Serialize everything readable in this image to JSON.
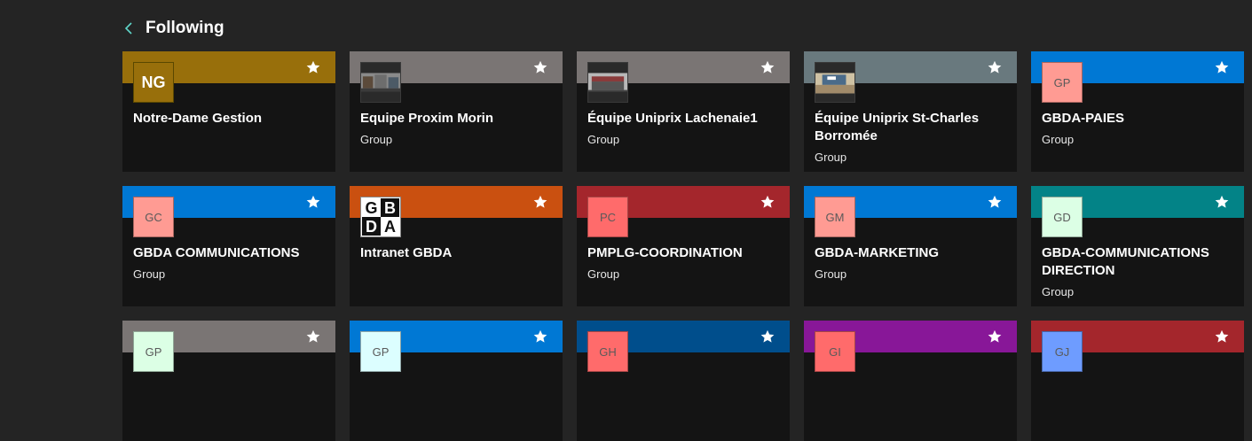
{
  "header": {
    "title": "Following"
  },
  "cards": [
    {
      "name": "Notre-Dame Gestion",
      "type": "",
      "initials": "NG",
      "band": "#986f0b",
      "logo_bg": "#986f0b",
      "logo_style": "bold"
    },
    {
      "name": "Equipe Proxim Morin",
      "type": "Group",
      "initials": "",
      "band": "#7a7574",
      "logo_bg": "#2a2a2a",
      "logo_style": "photo"
    },
    {
      "name": "Équipe Uniprix Lachenaie1",
      "type": "Group",
      "initials": "",
      "band": "#7a7574",
      "logo_bg": "#2a2a2a",
      "logo_style": "photo"
    },
    {
      "name": "Équipe Uniprix St-Charles Borromée",
      "type": "Group",
      "initials": "",
      "band": "#69797e",
      "logo_bg": "#2a2a2a",
      "logo_style": "photo"
    },
    {
      "name": "GBDA-PAIES",
      "type": "Group",
      "initials": "GP",
      "band": "#0078d4",
      "logo_bg": "#ff9b93",
      "logo_style": "initials"
    },
    {
      "name": "GBDA COMMUNICATIONS",
      "type": "Group",
      "initials": "GC",
      "band": "#0078d4",
      "logo_bg": "#ff9b93",
      "logo_style": "initials"
    },
    {
      "name": "Intranet GBDA",
      "type": "",
      "initials": "GBDA",
      "band": "#ca5010",
      "logo_bg": "#ffffff",
      "logo_style": "gbda"
    },
    {
      "name": "PMPLG-COORDINATION",
      "type": "Group",
      "initials": "PC",
      "band": "#a4262c",
      "logo_bg": "#ff6b6b",
      "logo_style": "initials"
    },
    {
      "name": "GBDA-MARKETING",
      "type": "Group",
      "initials": "GM",
      "band": "#0078d4",
      "logo_bg": "#ff9b93",
      "logo_style": "initials"
    },
    {
      "name": "GBDA-COMMUNICATIONS DIRECTION",
      "type": "Group",
      "initials": "GD",
      "band": "#038387",
      "logo_bg": "#dcffe5",
      "logo_style": "initials"
    },
    {
      "name": "",
      "type": "",
      "initials": "GP",
      "band": "#7a7574",
      "logo_bg": "#dcffe5",
      "logo_style": "initials"
    },
    {
      "name": "",
      "type": "",
      "initials": "GP",
      "band": "#0078d4",
      "logo_bg": "#dcfeff",
      "logo_style": "initials"
    },
    {
      "name": "",
      "type": "",
      "initials": "GH",
      "band": "#004e8c",
      "logo_bg": "#ff6b6b",
      "logo_style": "initials"
    },
    {
      "name": "",
      "type": "",
      "initials": "GI",
      "band": "#881798",
      "logo_bg": "#ff6b6b",
      "logo_style": "initials"
    },
    {
      "name": "",
      "type": "",
      "initials": "GJ",
      "band": "#a4262c",
      "logo_bg": "#6e9cff",
      "logo_style": "initials"
    }
  ],
  "icons": {
    "back": "chevron-left-icon",
    "favorite": "star-icon"
  },
  "colors": {
    "accent": "#5fd5c8",
    "background": "#242424",
    "card": "#141414"
  }
}
